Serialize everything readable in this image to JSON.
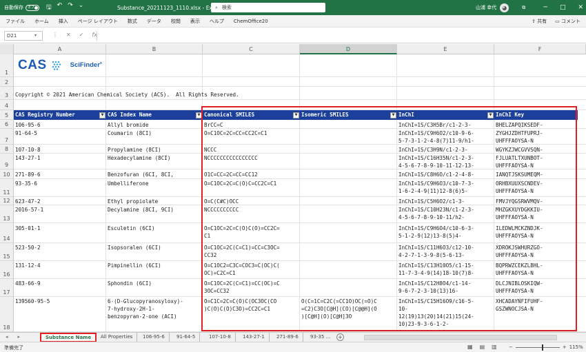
{
  "titlebar": {
    "autosave_label": "自動保存",
    "autosave_state": "オフ",
    "save_icon": "save-icon",
    "undo_icon": "undo-icon",
    "redo_icon": "redo-icon",
    "customize_icon": "chevron-down-icon",
    "doc_title": "Substance_20211123_1110.xlsx  -  Excel",
    "search_placeholder": "検索",
    "user_name": "山浦 幸代",
    "ribbon_display_icon": "ribbon-display-icon",
    "minimize": "─",
    "maximize": "□",
    "close": "✕"
  },
  "menu": {
    "items": [
      "ファイル",
      "ホーム",
      "挿入",
      "ページ レイアウト",
      "数式",
      "データ",
      "校閲",
      "表示",
      "ヘルプ",
      "ChemOffice20"
    ],
    "share": "共有",
    "comments": "コメント"
  },
  "formula": {
    "namebox": "D21",
    "content": ""
  },
  "columns": [
    "A",
    "B",
    "C",
    "D",
    "E",
    "F"
  ],
  "selected_column": "D",
  "row_numbers": [
    "1",
    "2",
    "3",
    "4",
    "5",
    "6",
    "7",
    "8",
    "9",
    "10",
    "11",
    "12",
    "13",
    "14",
    "15",
    "16",
    "17",
    "18"
  ],
  "logo": {
    "cas": "CAS",
    "product": "SciFinder"
  },
  "copyright": "Copyright © 2021 American Chemical Society (ACS).  All Rights Reserved.",
  "headers": {
    "cas_rn": "CAS Registry Number",
    "index_name": "CAS Index Name",
    "canonical": "Canonical SMILES",
    "isomeric": "Isomeric SMILES",
    "inchi": "InChI",
    "inchikey": "InChI Key"
  },
  "rows": [
    {
      "cas": "106-95-6",
      "name": "Allyl bromide",
      "can": "BrCC=C",
      "iso": "",
      "inchi": "InChI=1S/C3H5Br/c1-2-3-",
      "key": "BHELZAPQIKSEDF-"
    },
    {
      "cas": "91-64-5",
      "name": "Coumarin (8CI)",
      "can": "O=C1OC=2C=CC=CC2C=C1",
      "iso": "",
      "inchi": "InChI=1S/C9H6O2/c10-9-6-\n5-7-3-1-2-4-8(7)11-9/h1-",
      "key": "ZYGHJZDHTFUPRJ-\nUHFFFAOYSA-N"
    },
    {
      "cas": "107-10-8",
      "name": "Propylamine (8CI)",
      "can": "NCCC",
      "iso": "",
      "inchi": "InChI=1S/C3H9N/c1-2-3-",
      "key": "WGYKZJWCGVVSQN-"
    },
    {
      "cas": "143-27-1",
      "name": "Hexadecylamine (8CI)",
      "can": "NCCCCCCCCCCCCCCCC",
      "iso": "",
      "inchi": "InChI=1S/C16H35N/c1-2-3-\n4-5-6-7-8-9-10-11-12-13-",
      "key": "FJLUATLTXUNBOT-\nUHFFFAOYSA-N"
    },
    {
      "cas": "271-89-6",
      "name": "Benzofuran (6CI, 8CI,",
      "can": "O1C=CC=2C=CC=CC12",
      "iso": "",
      "inchi": "InChI=1S/C8H6O/c1-2-4-8-",
      "key": "IANQTJSKSUMEQM-"
    },
    {
      "cas": "93-35-6",
      "name": "Umbelliferone",
      "can": "O=C1OC=2C=C(O)C=CC2C=C1",
      "iso": "",
      "inchi": "InChI=1S/C9H6O3/c10-7-3-\n1-6-2-4-9(11)12-8(6)5-",
      "key": "ORHBXUUXSCNDEV-\nUHFFFAOYSA-N"
    },
    {
      "cas": "623-47-2",
      "name": "Ethyl propiolate",
      "can": "O=C(C#C)OCC",
      "iso": "",
      "inchi": "InChI=1S/C5H6O2/c1-3-",
      "key": "FMVJYQGSRWVMQV-"
    },
    {
      "cas": "2016-57-1",
      "name": "Decylamine (8CI, 9CI)",
      "can": "NCCCCCCCCCC",
      "iso": "",
      "inchi": "InChI=1S/C10H23N/c1-2-3-\n4-5-6-7-8-9-10-11/h2-",
      "key": "MHZGKXUYDGKKIU-\nUHFFFAOYSA-N"
    },
    {
      "cas": "305-01-1",
      "name": "Esculetin (6CI)",
      "can": "O=C1OC=2C=C(O)C(O)=CC2C=\nC1",
      "iso": "",
      "inchi": "InChI=1S/C9H6O4/c10-6-3-\n5-1-2-9(12)13-8(5)4-",
      "key": "ILEDWLMCKZNDJK-\nUHFFFAOYSA-N"
    },
    {
      "cas": "523-50-2",
      "name": "Isopsoralen (6CI)",
      "can": "O=C1OC=2C(C=C1)=CC=C3OC=\nCC32",
      "iso": "",
      "inchi": "InChI=1S/C11H6O3/c12-10-\n4-2-7-1-3-9-8(5-6-13-",
      "key": "XDROKJSWHURZGO-\nUHFFFAOYSA-N"
    },
    {
      "cas": "131-12-4",
      "name": "Pimpinellin (6CI)",
      "can": "O=C1OC2=C3C=COC3=C(OC)C(\nOC)=C2C=C1",
      "iso": "",
      "inchi": "InChI=1S/C13H10O5/c1-15-\n11-7-3-4-9(14)18-10(7)8-",
      "key": "BQPRWZCEKZLBHL-\nUHFFFAOYSA-N"
    },
    {
      "cas": "483-66-9",
      "name": "Sphondin (6CI)",
      "can": "O=C1OC=2C(C=C1)=CC(OC)=C\n3OC=CC32",
      "iso": "",
      "inchi": "InChI=1S/C12H8O4/c1-14-\n9-6-7-2-3-10(13)16-",
      "key": "DLCJNIBLOSKIQW-\nUHFFFAOYSA-N"
    },
    {
      "cas": "139560-95-5",
      "name": "6-(D-Glucopyranosyloxy)-\n7-hydroxy-2H-1-\nbenzopyran-2-one (ACI)",
      "can": "O=C1C=2C=C(O)C(OC3OC(CO\n)C(O)C(O)C3O)=CC2C=C1",
      "iso": "O(C=1C=C2C(=CC1O)OC(=O)C\n=C2)C3O[C@H](CO)[C@@H](O\n)[C@H](O)[C@H]3O",
      "inchi": "InChI=1S/C15H16O9/c16-5-\n10-\n12(19)13(20)14(21)15(24-\n10)23-9-3-6-1-2-",
      "key": "XHCADAYNFIFUHF-\nGSZWNOCJSA-N"
    }
  ],
  "sheet_tabs": [
    "Substance Name",
    "All Properties",
    "106-95-6",
    "91-64-5",
    "107-10-8",
    "143-27-1",
    "271-89-6",
    "93-35"
  ],
  "active_sheet": "Substance Name",
  "status": {
    "ready": "準備完了",
    "zoom": "115%"
  },
  "colors": {
    "excel_green": "#217346",
    "header_blue": "#1b3f9a",
    "highlight_red": "#e02020",
    "cas_blue": "#1b5bb5"
  }
}
